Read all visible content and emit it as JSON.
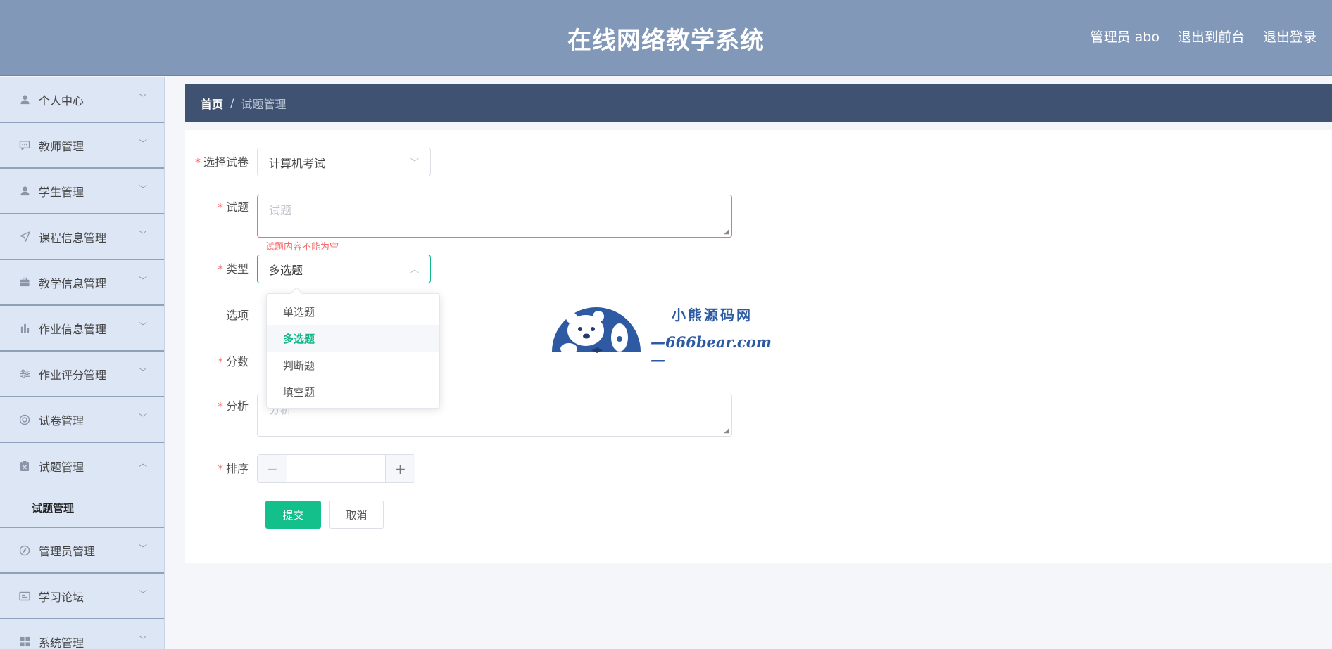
{
  "header": {
    "title": "在线网络教学系统",
    "links": [
      "管理员 abo",
      "退出到前台",
      "退出登录"
    ]
  },
  "sidebar": {
    "items": [
      {
        "label": "个人中心",
        "icon": "user-icon"
      },
      {
        "label": "教师管理",
        "icon": "chat-icon"
      },
      {
        "label": "学生管理",
        "icon": "user-icon"
      },
      {
        "label": "课程信息管理",
        "icon": "send-icon"
      },
      {
        "label": "教学信息管理",
        "icon": "briefcase-icon"
      },
      {
        "label": "作业信息管理",
        "icon": "bar-chart-icon"
      },
      {
        "label": "作业评分管理",
        "icon": "sliders-icon"
      },
      {
        "label": "试卷管理",
        "icon": "lifebuoy-icon"
      },
      {
        "label": "试题管理",
        "icon": "clipboard-icon"
      },
      {
        "label": "管理员管理",
        "icon": "compass-icon"
      },
      {
        "label": "学习论坛",
        "icon": "card-icon"
      },
      {
        "label": "系统管理",
        "icon": "grid-icon"
      }
    ],
    "submenu_label": "试题管理"
  },
  "breadcrumb": {
    "home": "首页",
    "separator": "/",
    "current": "试题管理"
  },
  "form": {
    "paper_label": "选择试卷",
    "paper_value": "计算机考试",
    "question_label": "试题",
    "question_placeholder": "试题",
    "question_error": "试题内容不能为空",
    "type_label": "类型",
    "type_value": "多选题",
    "options_label": "选项",
    "score_label": "分数",
    "analysis_label": "分析",
    "analysis_placeholder": "分析",
    "order_label": "排序",
    "order_value": "",
    "submit_label": "提交",
    "cancel_label": "取消",
    "required_mark": "*"
  },
  "type_dropdown": {
    "options": [
      "单选题",
      "多选题",
      "判断题",
      "填空题"
    ],
    "selected_index": 1
  },
  "watermark": {
    "line1": "小熊源码网",
    "line2": "—666bear.com—"
  },
  "colors": {
    "header_bg": "#8198b9",
    "sidebar_bg": "#dce6f5",
    "breadcrumb_bg": "#3f5272",
    "primary": "#13c08c",
    "error": "#f56c6c"
  }
}
